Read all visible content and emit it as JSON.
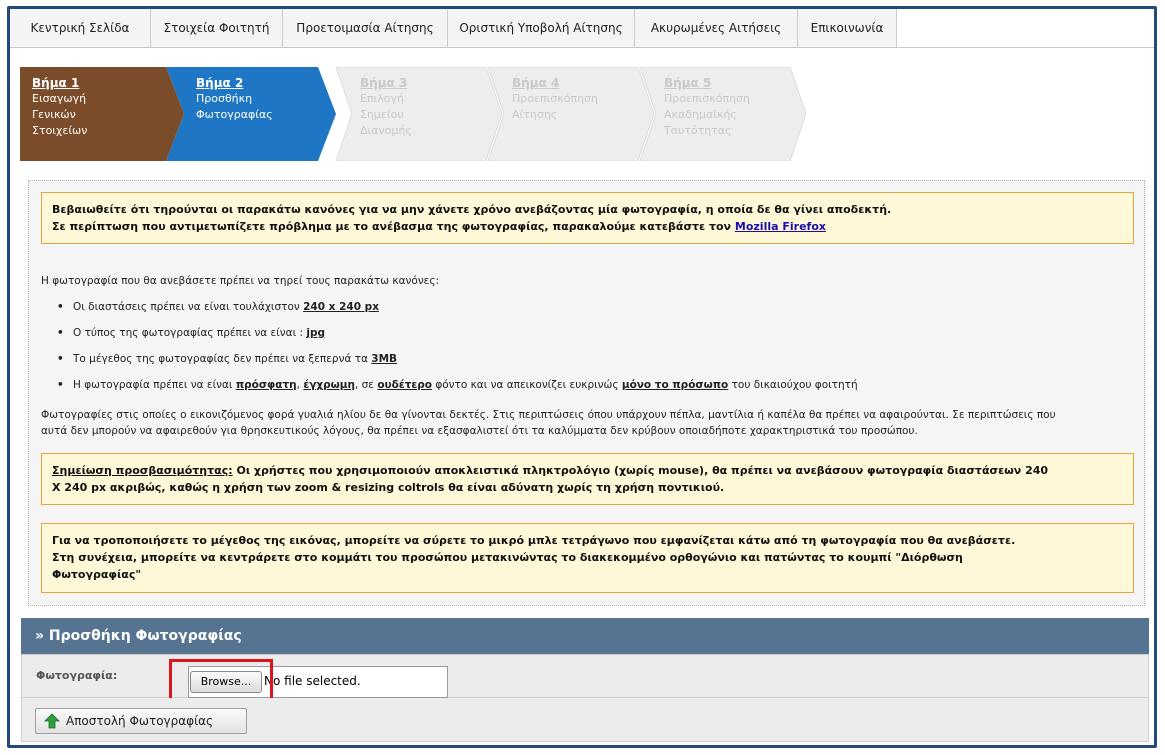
{
  "nav": {
    "tabs": [
      {
        "label": "Κεντρική Σελίδα"
      },
      {
        "label": "Στοιχεία Φοιτητή"
      },
      {
        "label": "Προετοιμασία Αίτησης"
      },
      {
        "label": "Οριστική Υποβολή Αίτησης"
      },
      {
        "label": "Ακυρωμένες Αιτήσεις"
      },
      {
        "label": "Επικοινωνία"
      }
    ]
  },
  "steps": [
    {
      "title": "Βήμα 1",
      "line1": "Εισαγωγή Γενικών",
      "line2": "Στοιχείων",
      "line3": "",
      "state": "done"
    },
    {
      "title": "Βήμα 2",
      "line1": "Προσθήκη",
      "line2": "Φωτογραφίας",
      "line3": "",
      "state": "active"
    },
    {
      "title": "Βήμα 3",
      "line1": "Επιλογή Σημείου",
      "line2": "Διανομής",
      "line3": "",
      "state": "pending"
    },
    {
      "title": "Βήμα 4",
      "line1": "Προεπισκόπηση",
      "line2": "Αίτησης",
      "line3": "",
      "state": "pending"
    },
    {
      "title": "Βήμα 5",
      "line1": "Προεπισκόπηση",
      "line2": "Ακαδημαϊκής",
      "line3": "Ταυτότητας",
      "state": "pending"
    }
  ],
  "colors": {
    "step_done": "#7a4c2a",
    "step_active": "#1f76c4",
    "step_pending": "#ededed",
    "panel_header": "#577392",
    "warning_border": "#e7a43a"
  },
  "warning1": {
    "line1": "Βεβαιωθείτε ότι τηρούνται οι παρακάτω κανόνες για να μην χάνετε χρόνο ανεβάζοντας μία φωτογραφία, η οποία δε θα γίνει αποδεκτή.",
    "line2": "Σε περίπτωση που αντιμετωπίζετε πρόβλημα με το ανέβασμα της φωτογραφίας, παρακαλούμε κατεβάστε τον",
    "link": "Mozilla Firefox"
  },
  "rules_intro": "Η φωτογραφία που θα ανεβάσετε πρέπει να τηρεί τους παρακάτω κανόνες:",
  "rules": {
    "r1_text": "Οι διαστάσεις πρέπει να είναι τουλάχιστον",
    "r1_bold": "240 x 240 px",
    "r2_text": "Ο τύπος της φωτογραφίας πρέπει να είναι :",
    "r2_bold": "jpg",
    "r3_text": "Το μέγεθος της φωτογραφίας δεν πρέπει να ξεπερνά τα",
    "r3_bold": "3MB",
    "r4_a": "Η φωτογραφία πρέπει να είναι",
    "r4_b1": "πρόσφατη",
    "r4_sep1": ",",
    "r4_b2": "έγχρωμη",
    "r4_sep2": ", σε",
    "r4_b3": "ουδέτερο",
    "r4_c": "φόντο και να απεικονίζει ευκρινώς",
    "r4_b4": "μόνο το πρόσωπο",
    "r4_d": "του δικαιούχου φοιτητή"
  },
  "glasses_line1": "Φωτογραφίες στις οποίες ο εικονιζόμενος φορά γυαλιά ηλίου δε θα γίνονται δεκτές. Στις περιπτώσεις όπου υπάρχουν πέπλα, μαντίλια ή καπέλα θα πρέπει να αφαιρούνται. Σε περιπτώσεις που",
  "glasses_line2": "αυτά δεν μπορούν να αφαιρεθούν για θρησκευτικούς λόγους, θα πρέπει να εξασφαλιστεί ότι τα καλύμματα δεν κρύβουν οποιαδήποτε χαρακτηριστικά του προσώπου.",
  "accessibility": {
    "label": "Σημείωση προσβασιμότητας:",
    "line1": "Οι χρήστες που χρησιμοποιούν αποκλειστικά πληκτρολόγιο (χωρίς mouse), θα πρέπει να ανεβάσουν φωτογραφία διαστάσεων 240",
    "line2": "X 240 px ακριβώς, καθώς η χρήση των zoom & resizing coltrols θα είναι αδύνατη χωρίς τη χρήση ποντικιού."
  },
  "resize_note": {
    "line1": "Για να τροποποιήσετε το μέγεθος της εικόνας, μπορείτε να σύρετε το μικρό μπλε τετράγωνο που εμφανίζεται κάτω από τη φωτογραφία που θα ανεβάσετε.",
    "line2": "Στη συνέχεια, μπορείτε να κεντράρετε στο κομμάτι του προσώπου μετακινώντας το διακεκομμένο ορθογώνιο και πατώντας το κουμπί \"Διόρθωση",
    "line3": "Φωτογραφίας\""
  },
  "upload": {
    "header": "» Προσθήκη Φωτογραφίας",
    "field_label": "Φωτογραφία:",
    "browse_label": "Browse...",
    "file_status": "No file selected.",
    "submit_label": "Αποστολή Φωτογραφίας"
  }
}
